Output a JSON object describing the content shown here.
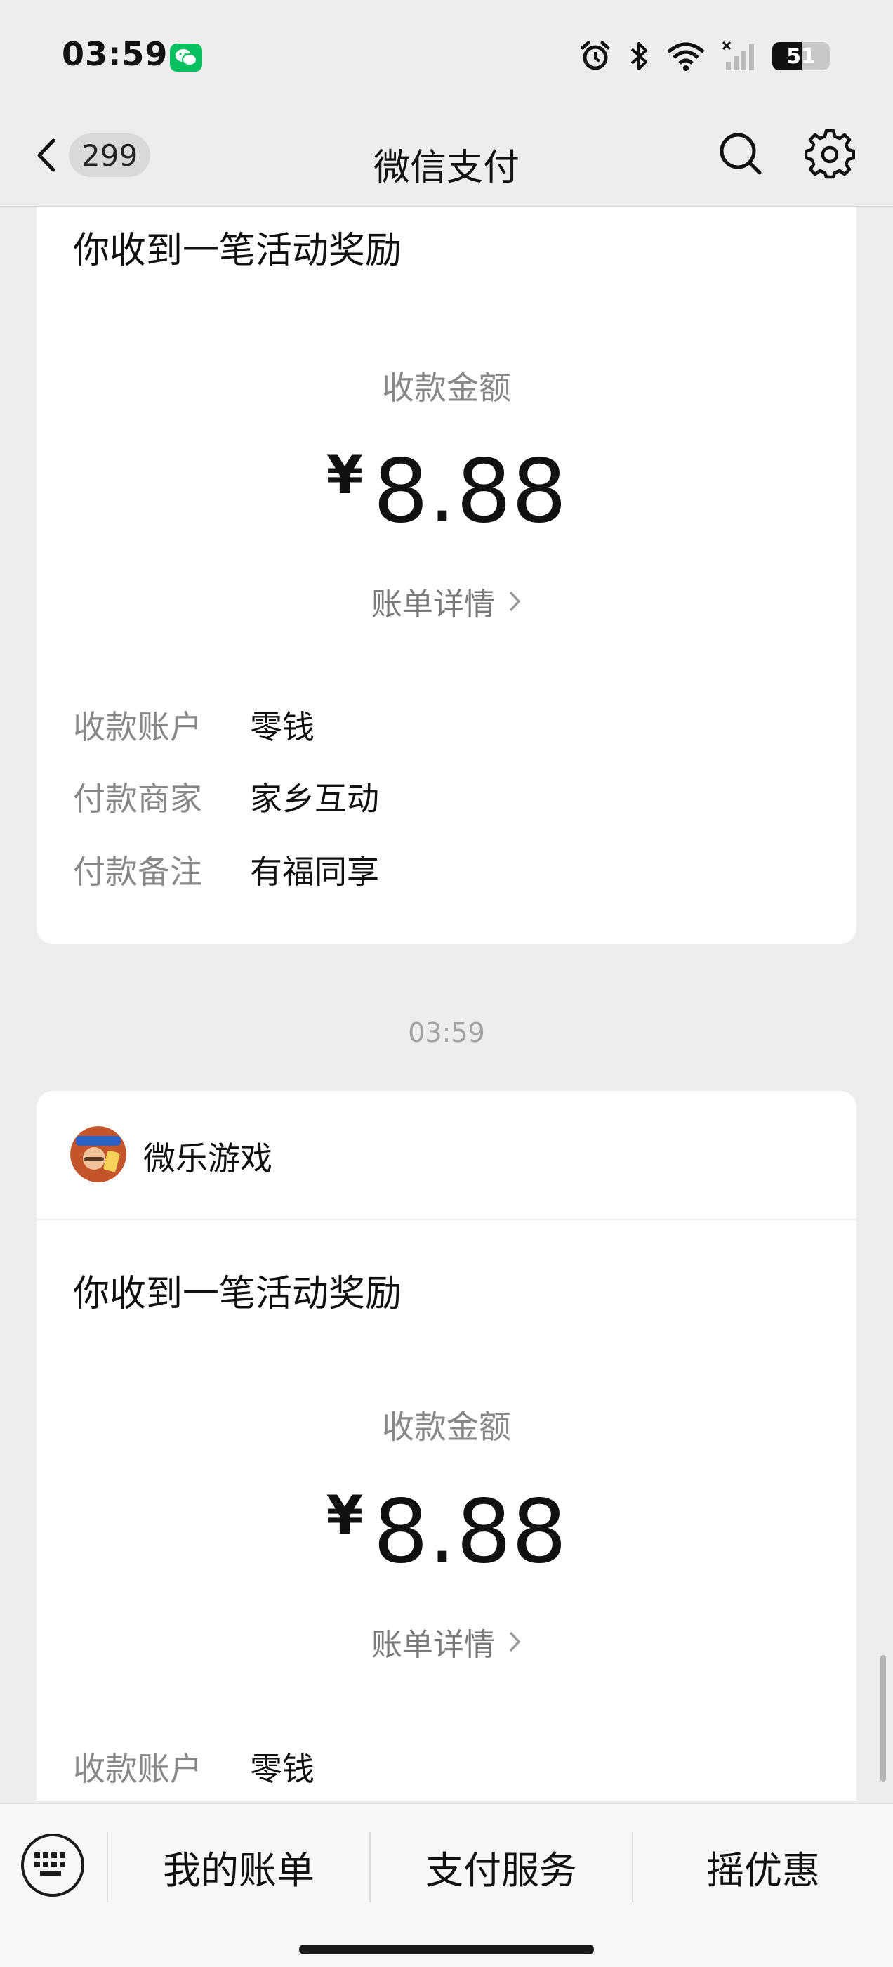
{
  "status_bar": {
    "time": "03:59",
    "battery_level": "51",
    "icons": [
      "wechat-icon",
      "alarm-icon",
      "bluetooth-icon",
      "wifi-icon",
      "cellular-signal-icon",
      "battery-icon"
    ]
  },
  "nav": {
    "badge": "299",
    "title": "微信支付",
    "icons": [
      "back-chevron-icon",
      "search-icon",
      "gear-icon"
    ]
  },
  "cards": [
    {
      "title": "你收到一笔活动奖励",
      "amount_label": "收款金额",
      "currency": "¥",
      "amount": "8.88",
      "bill_link": "账单详情",
      "rows": [
        {
          "key": "收款账户",
          "value": "零钱"
        },
        {
          "key": "付款商家",
          "value": "家乡互动"
        },
        {
          "key": "付款备注",
          "value": "有福同享"
        }
      ]
    },
    {
      "app_name": "微乐游戏",
      "title": "你收到一笔活动奖励",
      "amount_label": "收款金额",
      "currency": "¥",
      "amount": "8.88",
      "bill_link": "账单详情",
      "rows": [
        {
          "key": "收款账户",
          "value": "零钱"
        }
      ]
    }
  ],
  "timestamp": "03:59",
  "bottom_menu": {
    "items": [
      "我的账单",
      "支付服务",
      "摇优惠"
    ],
    "icons": [
      "keyboard-icon"
    ]
  },
  "colors": {
    "background": "#ededed",
    "card": "#ffffff",
    "wechat_green": "#07c160",
    "secondary_text": "#888888"
  }
}
